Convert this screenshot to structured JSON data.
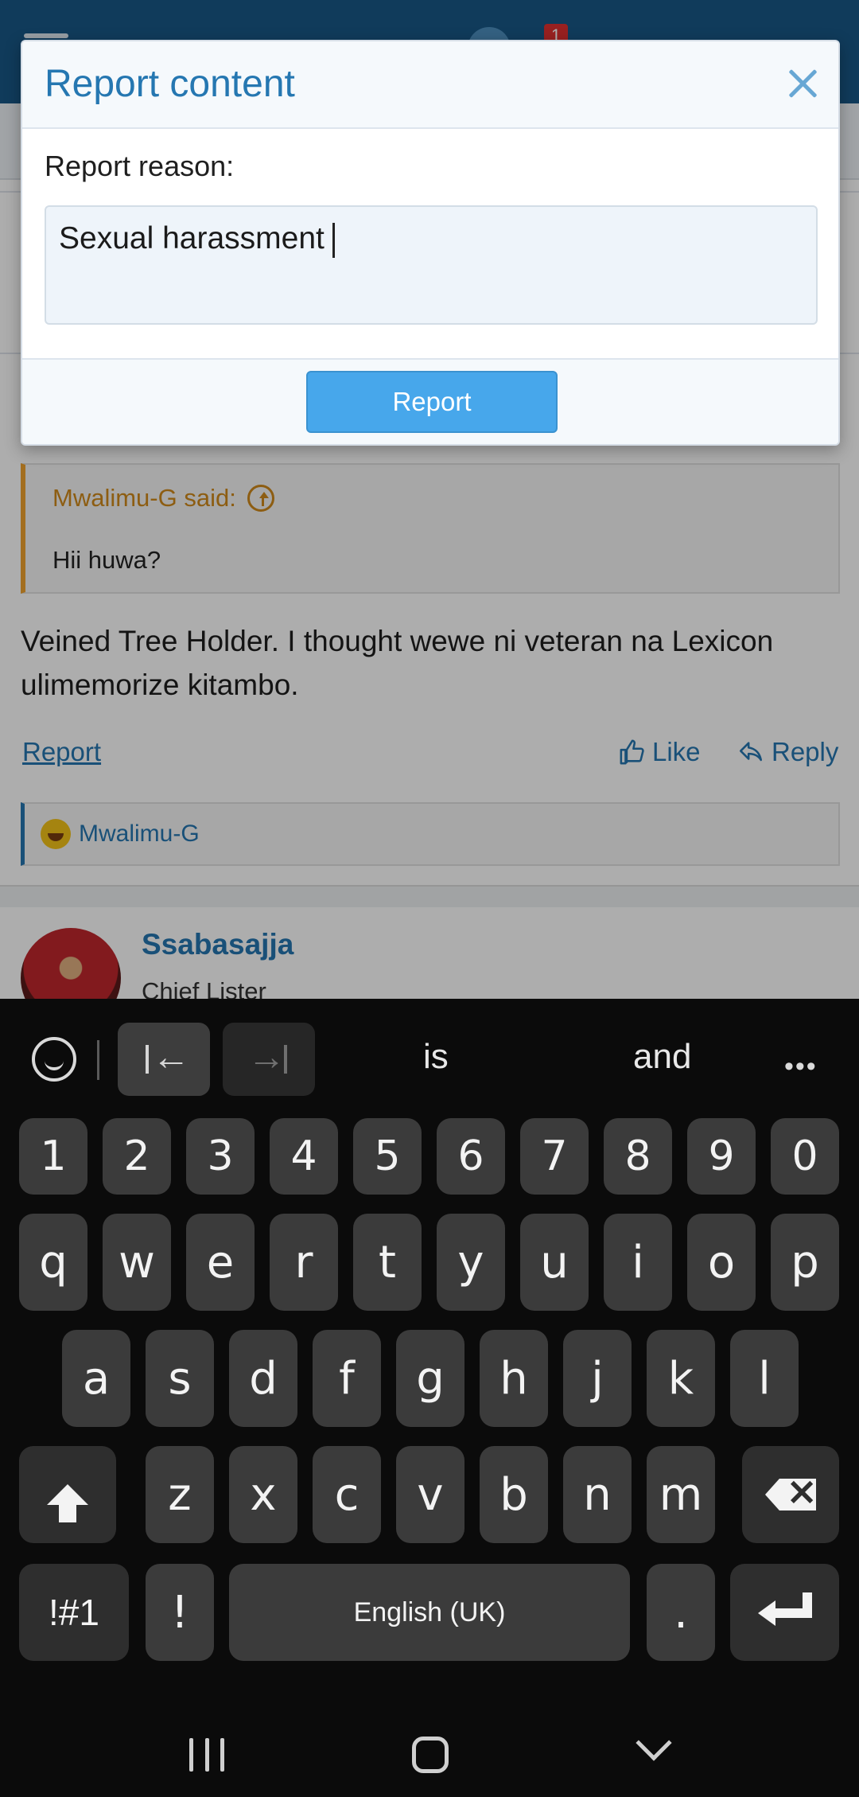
{
  "topbar": {
    "notification_count": "1"
  },
  "quote": {
    "author": "Mwalimu-G said:",
    "text": "Hii huwa?"
  },
  "post": {
    "body": "Veined Tree Holder. I thought wewe ni veteran na Lexicon ulimemorize kitambo.",
    "report_label": "Report",
    "like_label": "Like",
    "reply_label": "Reply",
    "reaction_user": "Mwalimu-G"
  },
  "next_post": {
    "username": "Ssabasajja",
    "user_title": "Chief Lister"
  },
  "modal": {
    "title": "Report content",
    "label": "Report reason:",
    "input_value": "Sexual harassment",
    "button_label": "Report"
  },
  "keyboard": {
    "suggestions": [
      "is",
      "and"
    ],
    "number_row": [
      "1",
      "2",
      "3",
      "4",
      "5",
      "6",
      "7",
      "8",
      "9",
      "0"
    ],
    "row1": [
      "q",
      "w",
      "e",
      "r",
      "t",
      "y",
      "u",
      "i",
      "o",
      "p"
    ],
    "row2": [
      "a",
      "s",
      "d",
      "f",
      "g",
      "h",
      "j",
      "k",
      "l"
    ],
    "row3": [
      "z",
      "x",
      "c",
      "v",
      "b",
      "n",
      "m"
    ],
    "symbols_label": "!#1",
    "exclaim_label": "!",
    "space_label": "English (UK)",
    "period_label": "."
  },
  "colors": {
    "accent": "#2577b1",
    "quote_accent": "#f0a32f",
    "button": "#47a7eb",
    "topbar": "#185886"
  }
}
